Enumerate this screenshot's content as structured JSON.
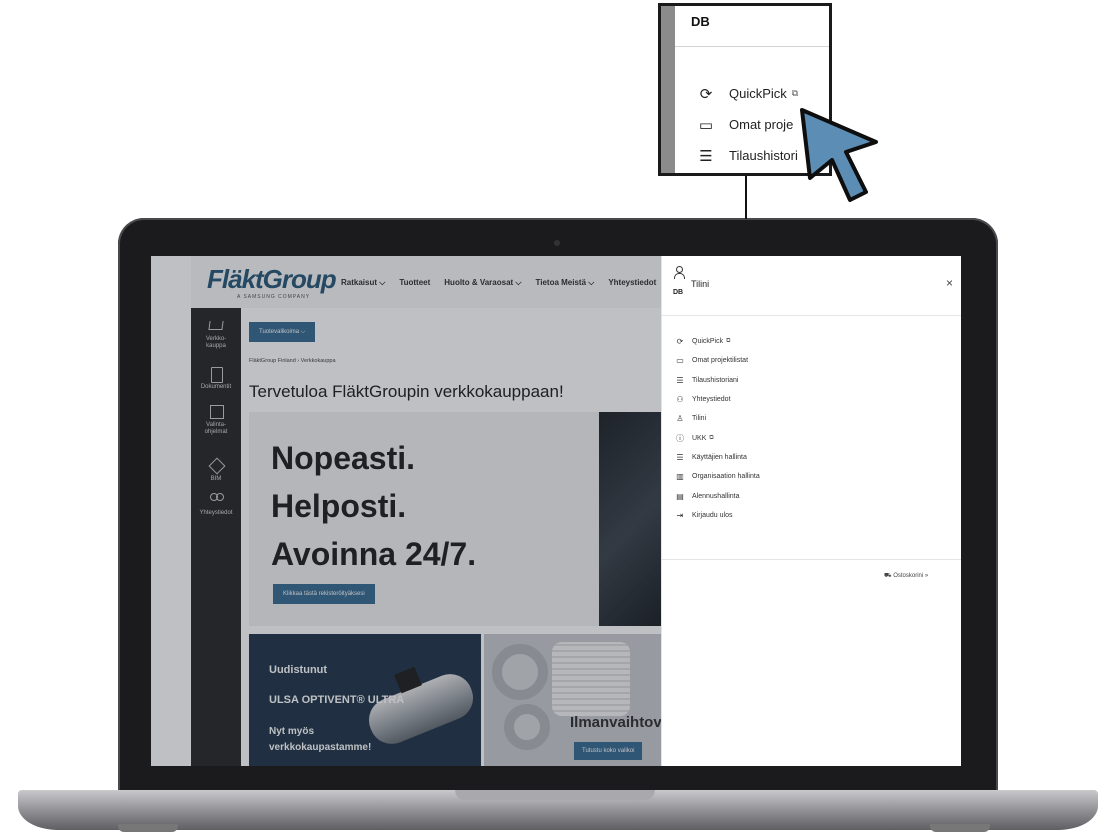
{
  "site": {
    "logo": "FläktGroup",
    "logo_sub": "A SAMSUNG COMPANY",
    "nav": [
      "Ratkaisut ⌵",
      "Tuotteet",
      "Huolto & Varaosat ⌵",
      "Tietoa Meistä ⌵",
      "Yhteystiedot"
    ],
    "rail": [
      {
        "label": "Verkko-\nkauppa",
        "icon": "cart-icon"
      },
      {
        "label": "Dokumentit",
        "icon": "document-icon"
      },
      {
        "label": "Valinta-\nohjelmat",
        "icon": "selection-tool-icon"
      },
      {
        "label": "BIM",
        "icon": "bim-cube-icon"
      },
      {
        "label": "Yhteystiedot",
        "icon": "contacts-icon"
      }
    ],
    "rail_bottom": "co",
    "product_button": "Tuotevalikoima ⌵",
    "breadcrumb": "FläktGroup Finland  ›  Verkkokauppa",
    "page_title": "Tervetuloa FläktGroupin verkkokauppaan!",
    "hero": {
      "line1": "Nopeasti.",
      "line2": "Helposti.",
      "line3": "Avoinna 24/7.",
      "button": "Klikkaa tästä rekisteröityäksesi"
    },
    "promo1": {
      "line1": "Uudistunut",
      "line2": "ULSA OPTIVENT® ULTRA",
      "line3": "Nyt myös",
      "line4": "verkkokaupastamme!"
    },
    "promo2": {
      "label": "Ilmanvaihtoven",
      "button": "Tutustu koko valikoi"
    }
  },
  "panel": {
    "initials": "DB",
    "title": "Tilini",
    "close": "×",
    "menu": [
      {
        "label": "QuickPick",
        "icon": "⟳",
        "ext": true
      },
      {
        "label": "Omat projektilistat",
        "icon": "▭",
        "ext": false
      },
      {
        "label": "Tilaushistoriani",
        "icon": "☰",
        "ext": false
      },
      {
        "label": "Yhteystiedot",
        "icon": "⚇",
        "ext": false
      },
      {
        "label": "Tilini",
        "icon": "♙",
        "ext": false
      },
      {
        "label": "UKK",
        "icon": "ⓘ",
        "ext": true
      },
      {
        "label": "Käyttäjien hallinta",
        "icon": "☰",
        "ext": false
      },
      {
        "label": "Organisaation hallinta",
        "icon": "▥",
        "ext": false
      },
      {
        "label": "Alennushallinta",
        "icon": "▤",
        "ext": false
      },
      {
        "label": "Kirjaudu ulos",
        "icon": "⇥",
        "ext": false
      }
    ],
    "cart": "⛟ Ostoskorini  »",
    "ext_icon": "⧉"
  },
  "callout": {
    "initials": "DB",
    "menu": [
      {
        "label": "QuickPick",
        "icon": "⟳",
        "ext": true
      },
      {
        "label": "Omat proje",
        "icon": "▭",
        "ext": false
      },
      {
        "label": "Tilaushistori",
        "icon": "☰",
        "ext": false
      }
    ]
  },
  "colors": {
    "accent": "#3a6c93",
    "pointer": "#5b8db5",
    "rail": "#2a2a2c"
  }
}
